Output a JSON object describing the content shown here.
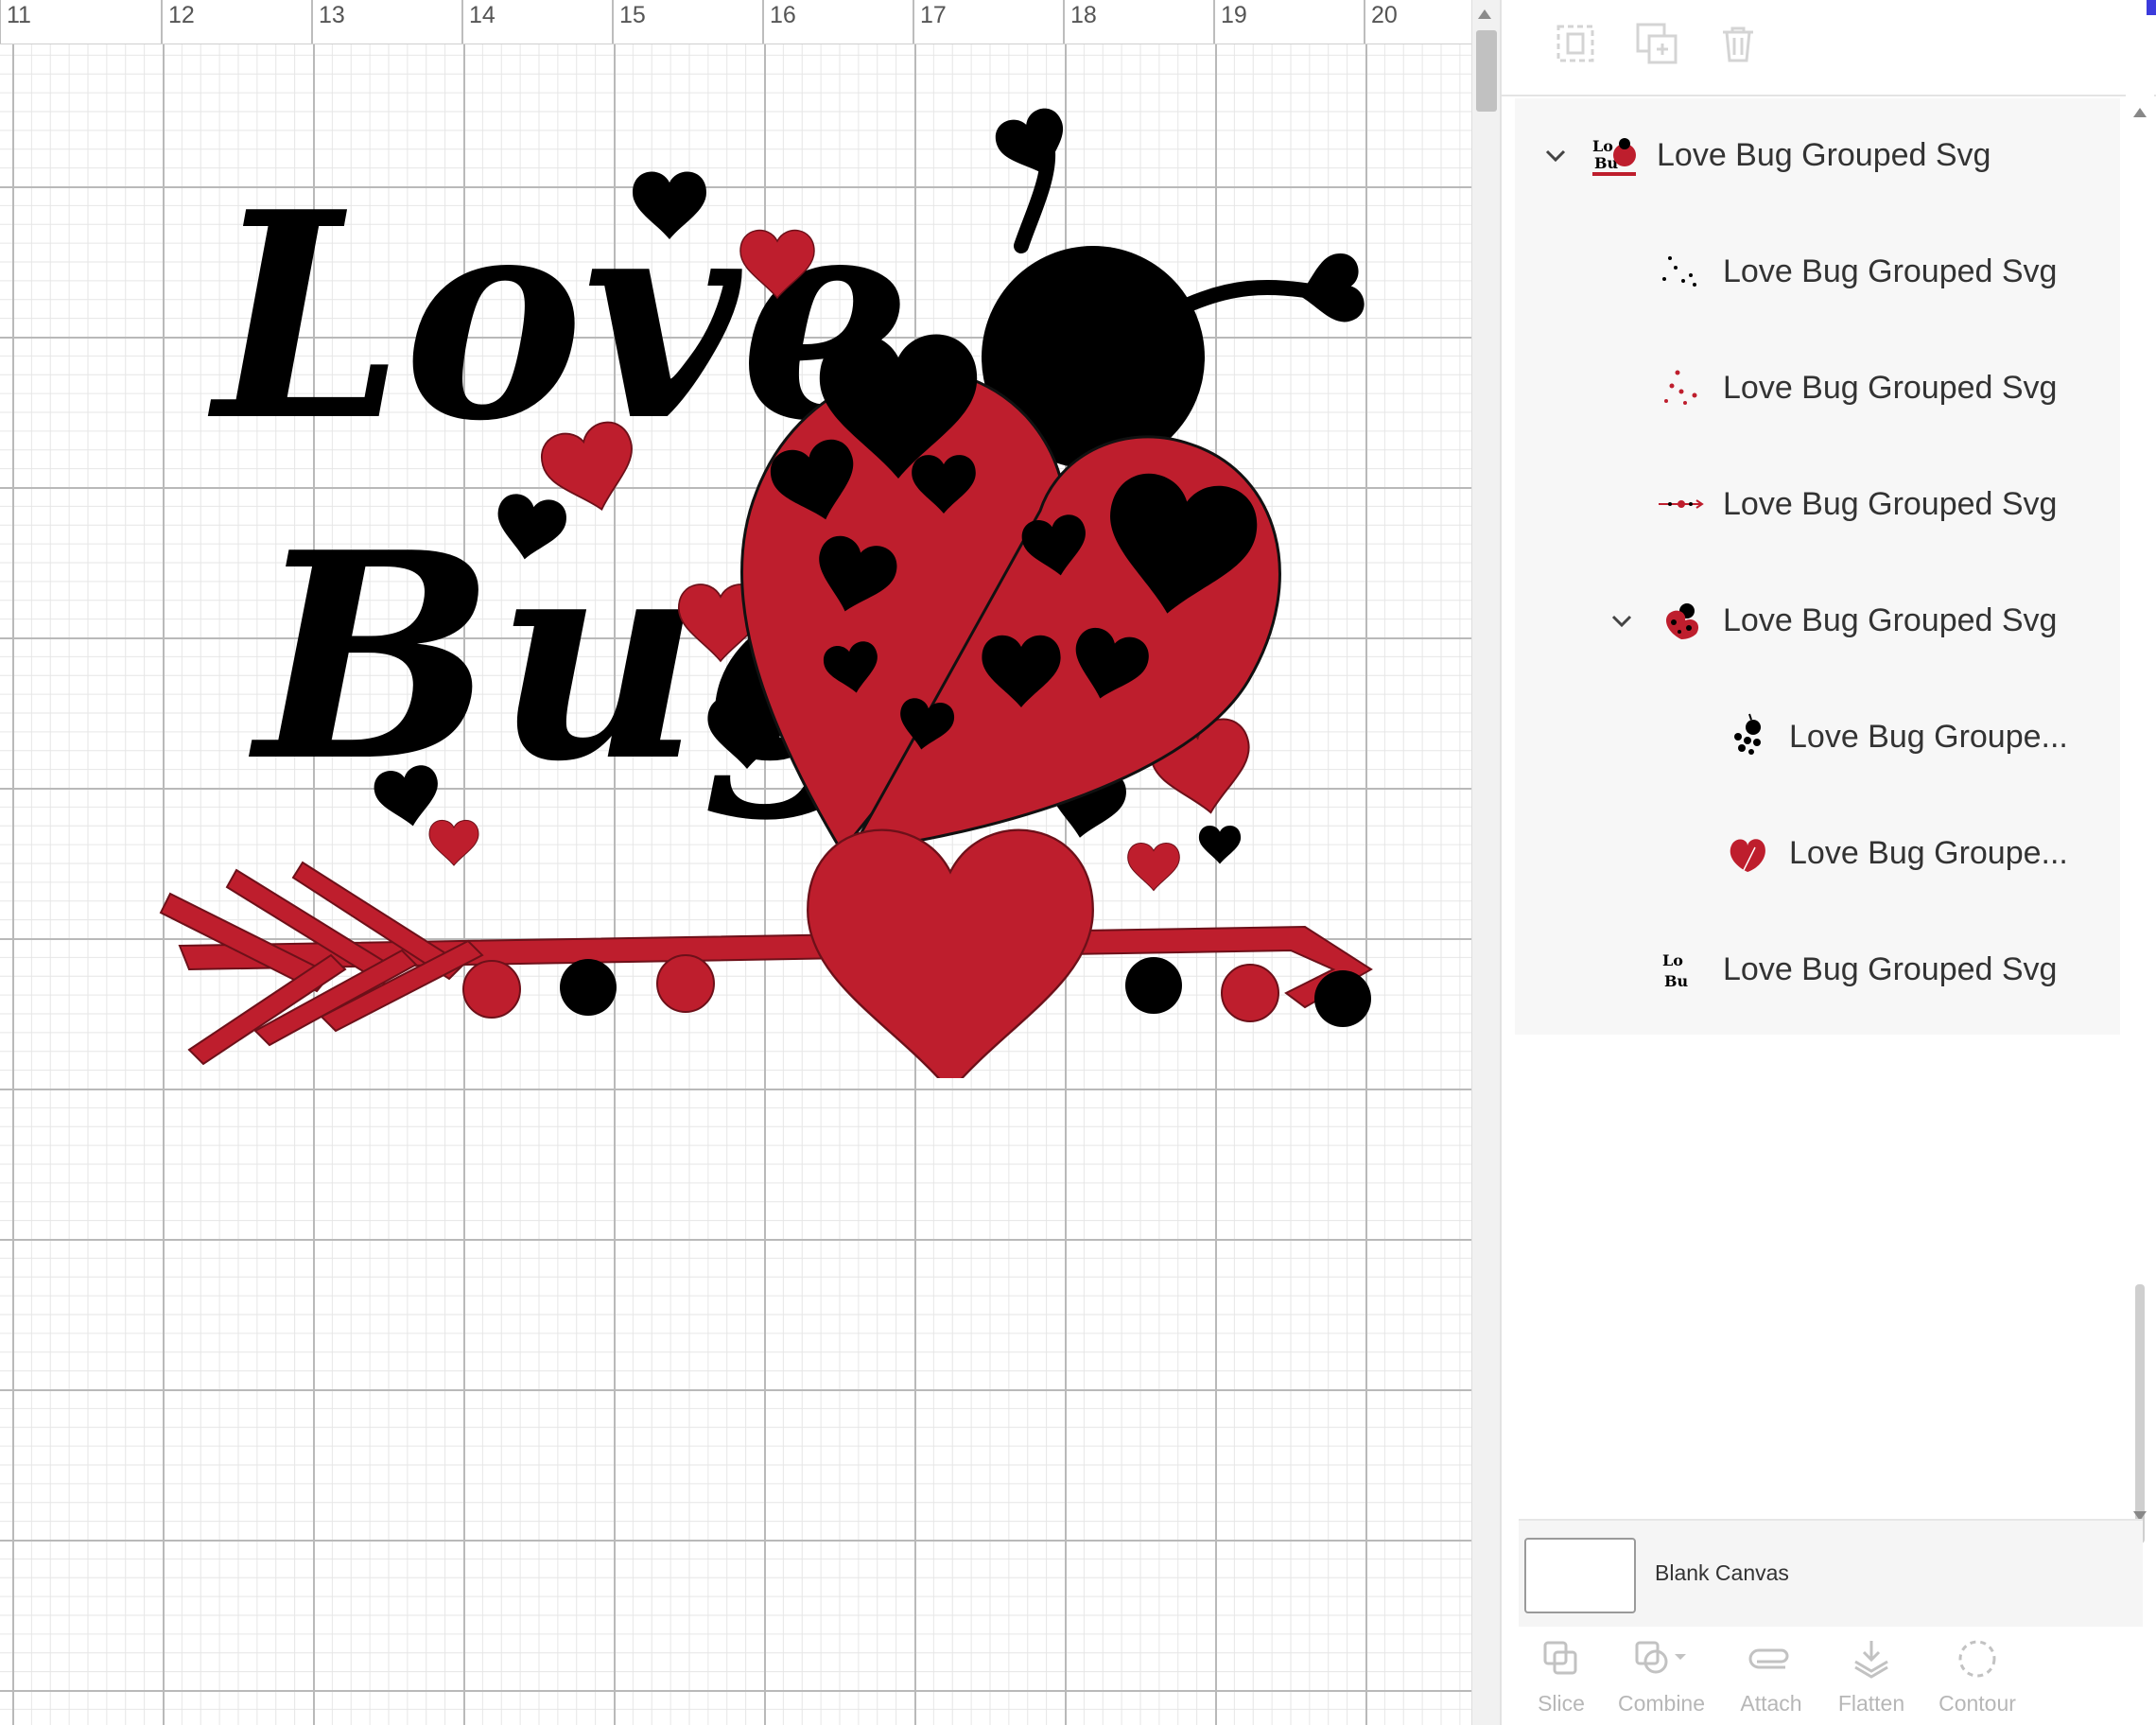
{
  "ruler": {
    "labels": [
      "11",
      "12",
      "13",
      "14",
      "15",
      "16",
      "17",
      "18",
      "19",
      "20"
    ]
  },
  "canvas": {
    "design_text": {
      "line1": "Love",
      "line2": "Bug"
    },
    "colors": {
      "red": "#be1e2d",
      "black": "#000000",
      "grid_major": "#b9b9b9",
      "grid_minor": "#e6e6e6"
    }
  },
  "top_toolbar": {
    "items": [
      {
        "name": "group-icon"
      },
      {
        "name": "duplicate-icon"
      },
      {
        "name": "delete-icon"
      }
    ]
  },
  "layers": {
    "items": [
      {
        "label": "Love Bug Grouped Svg",
        "expanded": true,
        "icon": "love-bug-group-thumbnail"
      },
      {
        "label": "Love Bug Grouped Svg",
        "icon": "small-hearts-black-thumbnail"
      },
      {
        "label": "Love Bug Grouped Svg",
        "icon": "small-hearts-red-thumbnail"
      },
      {
        "label": "Love Bug Grouped Svg",
        "icon": "arrow-thumbnail"
      },
      {
        "label": "Love Bug Grouped Svg",
        "expanded": true,
        "icon": "ladybug-thumbnail"
      },
      {
        "label": "Love Bug Groupe...",
        "icon": "ladybug-black-thumbnail"
      },
      {
        "label": "Love Bug Groupe...",
        "icon": "heart-red-thumbnail"
      },
      {
        "label": "Love Bug Grouped Svg",
        "icon": "love-bug-text-thumbnail"
      }
    ]
  },
  "blank_canvas": {
    "label": "Blank Canvas"
  },
  "bottom_tools": {
    "items": [
      {
        "label": "Slice",
        "icon": "slice-icon"
      },
      {
        "label": "Combine",
        "icon": "combine-icon"
      },
      {
        "label": "Attach",
        "icon": "attach-icon"
      },
      {
        "label": "Flatten",
        "icon": "flatten-icon"
      },
      {
        "label": "Contour",
        "icon": "contour-icon"
      }
    ]
  }
}
